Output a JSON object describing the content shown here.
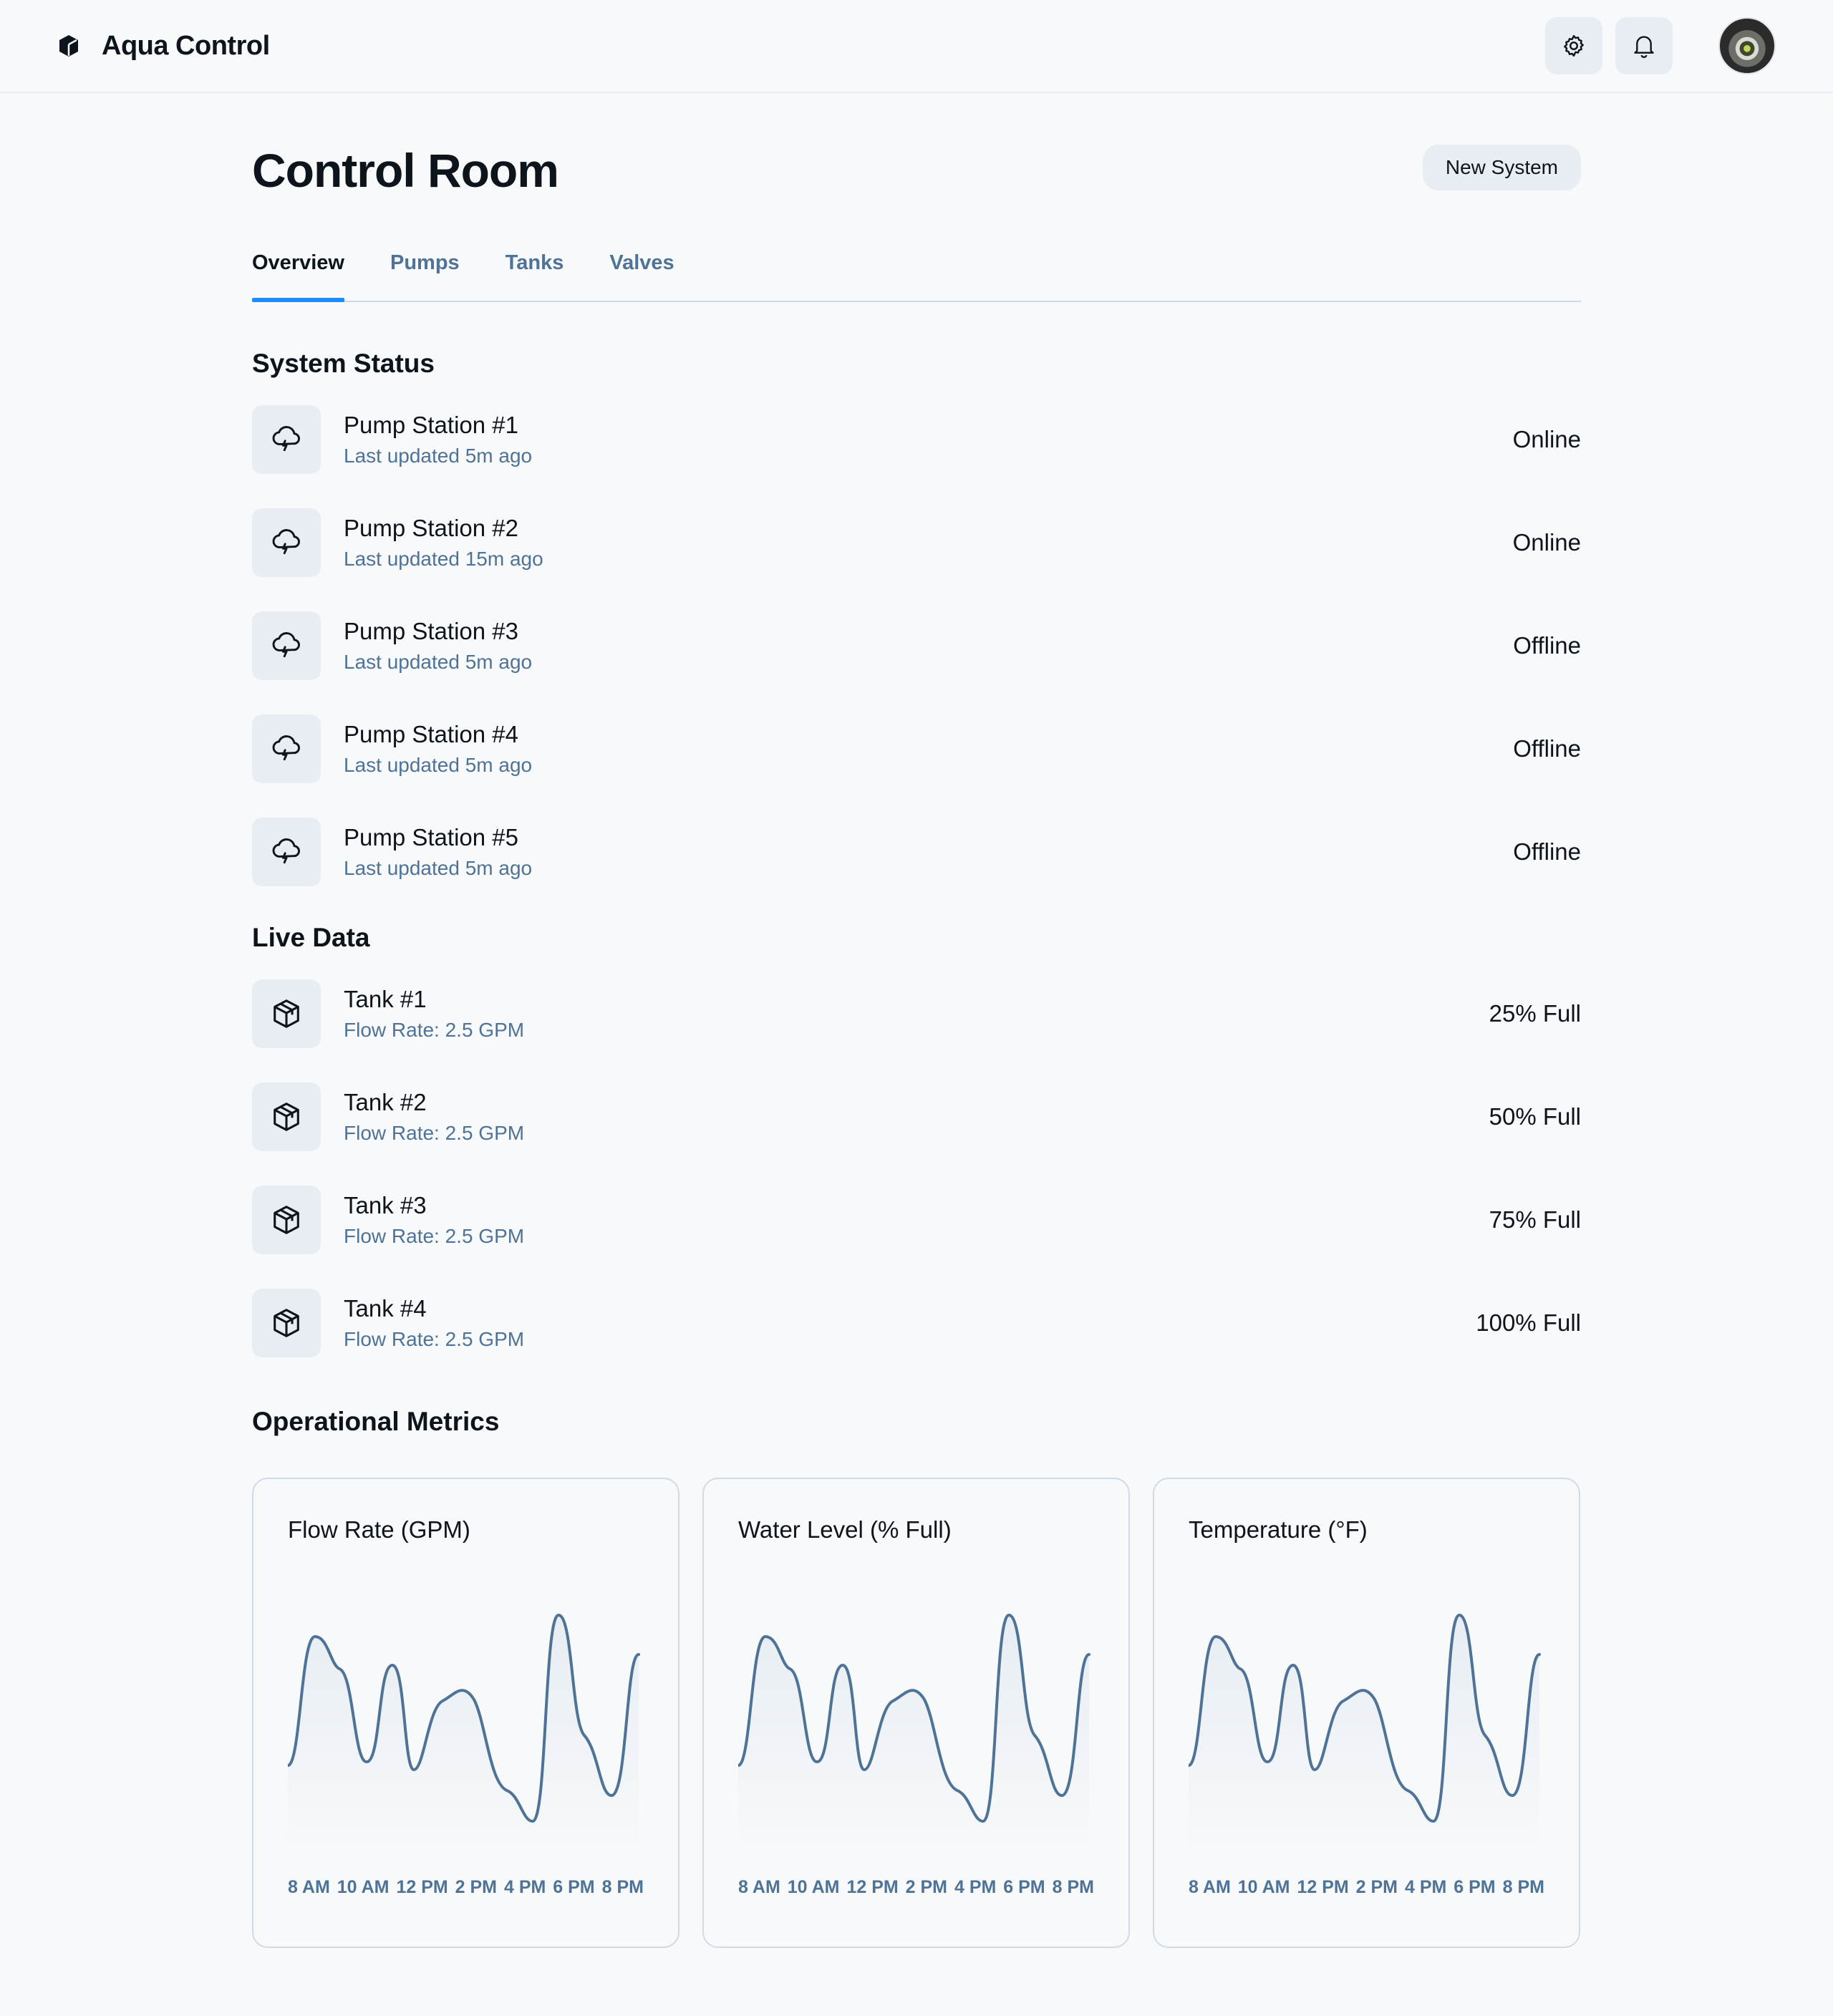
{
  "app": {
    "title": "Aqua Control"
  },
  "header": {
    "icons": [
      "settings-icon",
      "bell-icon"
    ]
  },
  "page": {
    "title": "Control Room",
    "new_button": "New System"
  },
  "tabs": [
    {
      "label": "Overview",
      "active": true
    },
    {
      "label": "Pumps",
      "active": false
    },
    {
      "label": "Tanks",
      "active": false
    },
    {
      "label": "Valves",
      "active": false
    }
  ],
  "system_status": {
    "title": "System Status",
    "items": [
      {
        "name": "Pump Station #1",
        "updated": "Last updated 5m ago",
        "status": "Online"
      },
      {
        "name": "Pump Station #2",
        "updated": "Last updated 15m ago",
        "status": "Online"
      },
      {
        "name": "Pump Station #3",
        "updated": "Last updated 5m ago",
        "status": "Offline"
      },
      {
        "name": "Pump Station #4",
        "updated": "Last updated 5m ago",
        "status": "Offline"
      },
      {
        "name": "Pump Station #5",
        "updated": "Last updated 5m ago",
        "status": "Offline"
      }
    ]
  },
  "live_data": {
    "title": "Live Data",
    "items": [
      {
        "name": "Tank #1",
        "flow": "Flow Rate: 2.5 GPM",
        "level": "25% Full"
      },
      {
        "name": "Tank #2",
        "flow": "Flow Rate: 2.5 GPM",
        "level": "50% Full"
      },
      {
        "name": "Tank #3",
        "flow": "Flow Rate: 2.5 GPM",
        "level": "75% Full"
      },
      {
        "name": "Tank #4",
        "flow": "Flow Rate: 2.5 GPM",
        "level": "100% Full"
      }
    ]
  },
  "metrics": {
    "title": "Operational Metrics",
    "x_ticks": [
      "8 AM",
      "10 AM",
      "12 PM",
      "2 PM",
      "4 PM",
      "6 PM",
      "8 PM"
    ],
    "cards": [
      {
        "title": "Flow Rate (GPM)"
      },
      {
        "title": "Water Level (% Full)"
      },
      {
        "title": "Temperature (°F)"
      }
    ]
  },
  "colors": {
    "accent": "#1d8cf8",
    "muted_text": "#4e7397",
    "line": "#4e7397",
    "surface": "#e7edf3"
  }
}
